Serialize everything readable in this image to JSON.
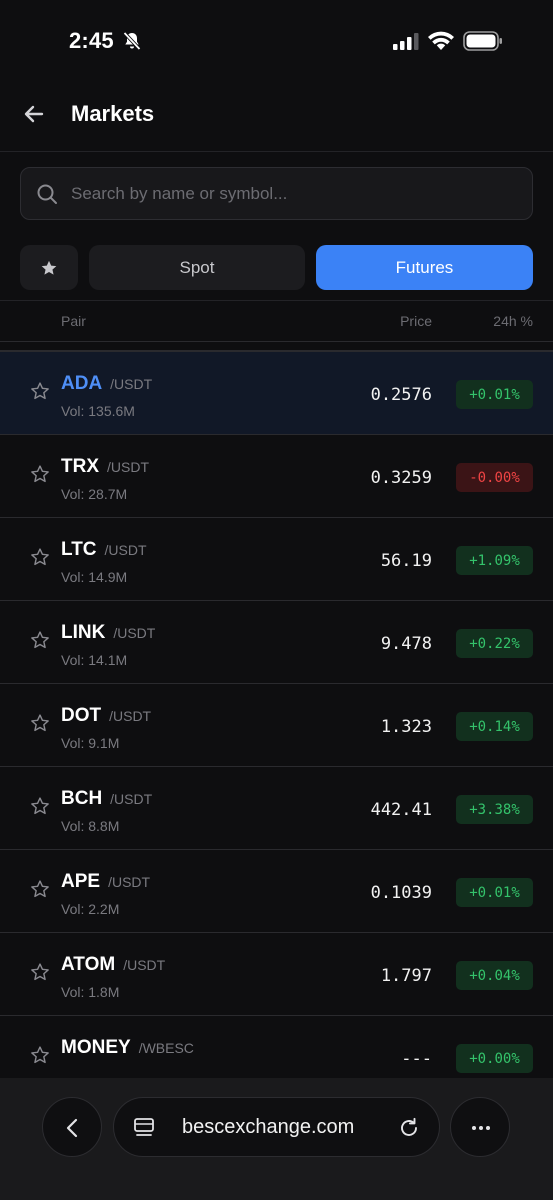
{
  "status": {
    "time": "2:45"
  },
  "header": {
    "title": "Markets"
  },
  "search": {
    "placeholder": "Search by name or symbol..."
  },
  "tabs": {
    "favorites_icon": "star-icon",
    "spot": "Spot",
    "futures": "Futures",
    "active": "Futures"
  },
  "list_header": {
    "pair": "Pair",
    "price": "Price",
    "change": "24h %"
  },
  "rows": [
    {
      "base": "ADA",
      "quote": "/USDT",
      "vol": "Vol: 135.6M",
      "price": "0.2576",
      "change": "+0.01%",
      "trend": "up",
      "selected": true
    },
    {
      "base": "TRX",
      "quote": "/USDT",
      "vol": "Vol: 28.7M",
      "price": "0.3259",
      "change": "-0.00%",
      "trend": "down"
    },
    {
      "base": "LTC",
      "quote": "/USDT",
      "vol": "Vol: 14.9M",
      "price": "56.19",
      "change": "+1.09%",
      "trend": "up"
    },
    {
      "base": "LINK",
      "quote": "/USDT",
      "vol": "Vol: 14.1M",
      "price": "9.478",
      "change": "+0.22%",
      "trend": "up"
    },
    {
      "base": "DOT",
      "quote": "/USDT",
      "vol": "Vol: 9.1M",
      "price": "1.323",
      "change": "+0.14%",
      "trend": "up"
    },
    {
      "base": "BCH",
      "quote": "/USDT",
      "vol": "Vol: 8.8M",
      "price": "442.41",
      "change": "+3.38%",
      "trend": "up"
    },
    {
      "base": "APE",
      "quote": "/USDT",
      "vol": "Vol: 2.2M",
      "price": "0.1039",
      "change": "+0.01%",
      "trend": "up"
    },
    {
      "base": "ATOM",
      "quote": "/USDT",
      "vol": "Vol: 1.8M",
      "price": "1.797",
      "change": "+0.04%",
      "trend": "up"
    },
    {
      "base": "MONEY",
      "quote": "/WBESC",
      "vol": "",
      "price": "---",
      "change": "+0.00%",
      "trend": "up"
    }
  ],
  "browser": {
    "url": "bescexchange.com"
  },
  "colors": {
    "accent": "#3b82f6",
    "up": "#34c36b",
    "down": "#ef4444",
    "background": "#0e0e10"
  }
}
